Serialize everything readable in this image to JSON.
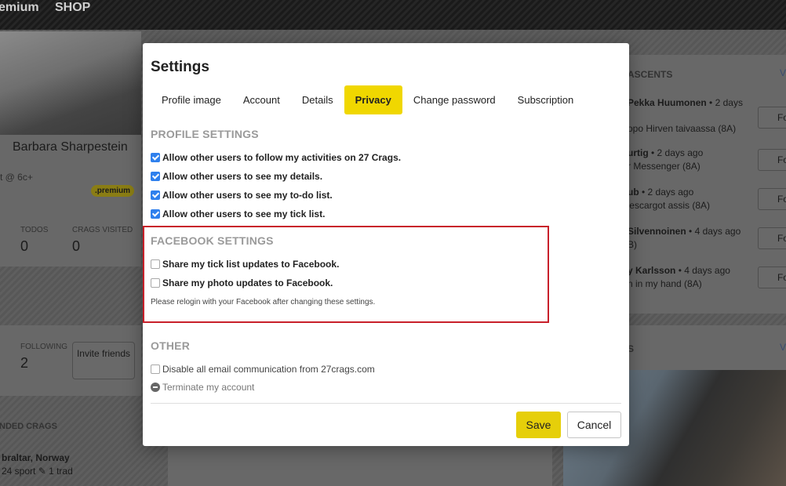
{
  "colors": {
    "accent": "#f0d700",
    "highlight_border": "#c8202a",
    "checkbox": "#2f80ed"
  },
  "topbar": {
    "premium": "emium",
    "shop": "SHOP"
  },
  "background": {
    "profile_name": "Barbara Sharpestein",
    "grade": "t @ 6c+",
    "premium_badge": ".premium",
    "todos_label": "TODOS",
    "todos_value": "0",
    "crags_visited_label": "CRAGS VISITED",
    "crags_visited_value": "0",
    "following_label": "FOLLOWING",
    "following_value": "2",
    "invite_label": "Invite friends",
    "recommended_crags": "NDED CRAGS",
    "crag_name": "braltar, Norway",
    "crag_stats": "24 sport ✎ 1 trad",
    "ascents_title": "ASCENTS",
    "ascents_view": "V",
    "ascents": [
      {
        "user": "Pekka Huumonen",
        "time": "• 2 days",
        "route": "opo Hirven taivaassa (8A)",
        "btn": "Fo"
      },
      {
        "user": "urtig",
        "time": "• 2 days ago",
        "route": "r Messenger (8A)",
        "btn": "Fo"
      },
      {
        "user": "ub",
        "time": "• 2 days ago",
        "route": "'escargot assis (8A)",
        "btn": "Fo"
      },
      {
        "user": "Silvennoinen",
        "time": "• 4 days ago",
        "route": "B)",
        "btn": "Fo"
      },
      {
        "user": "y Karlsson",
        "time": "• 4 days ago",
        "route": "n in my hand (8A)",
        "btn": "Fo"
      }
    ],
    "photos_title": "S",
    "photos_view": "V"
  },
  "modal": {
    "title": "Settings",
    "tabs": [
      {
        "label": "Profile image",
        "active": false
      },
      {
        "label": "Account",
        "active": false
      },
      {
        "label": "Details",
        "active": false
      },
      {
        "label": "Privacy",
        "active": true
      },
      {
        "label": "Change password",
        "active": false
      },
      {
        "label": "Subscription",
        "active": false
      }
    ],
    "profile_settings": {
      "title": "PROFILE SETTINGS",
      "options": [
        {
          "label": "Allow other users to follow my activities on 27 Crags.",
          "checked": true
        },
        {
          "label": "Allow other users to see my details.",
          "checked": true
        },
        {
          "label": "Allow other users to see my to-do list.",
          "checked": true
        },
        {
          "label": "Allow other users to see my tick list.",
          "checked": true
        }
      ]
    },
    "facebook_settings": {
      "title": "FACEBOOK SETTINGS",
      "options": [
        {
          "label": "Share my tick list updates to Facebook.",
          "checked": false
        },
        {
          "label": "Share my photo updates to Facebook.",
          "checked": false
        }
      ],
      "note": "Please relogin with your Facebook after changing these settings."
    },
    "other": {
      "title": "OTHER",
      "email_option": {
        "label": "Disable all email communication from 27crags.com",
        "checked": false
      },
      "terminate": "Terminate my account"
    },
    "save_label": "Save",
    "cancel_label": "Cancel"
  }
}
